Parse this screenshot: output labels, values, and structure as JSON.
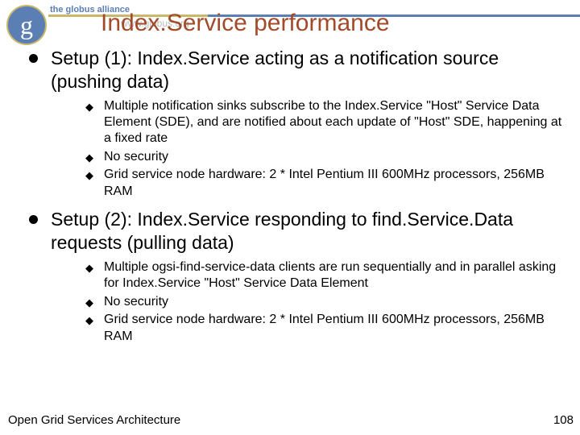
{
  "logo": {
    "title": "the globus alliance",
    "url": "www.globus.org",
    "g": "g"
  },
  "title": "Index.Service performance",
  "sections": [
    {
      "heading": "Setup (1): Index.Service acting as a notification source (pushing data)",
      "items": [
        "Multiple notification sinks subscribe to the Index.Service \"Host\" Service Data Element (SDE), and are notified about each update of \"Host\" SDE, happening at a fixed rate",
        "No security",
        "Grid service node hardware: 2 * Intel Pentium III 600MHz processors, 256MB RAM"
      ]
    },
    {
      "heading": "Setup (2): Index.Service responding to find.Service.Data requests (pulling data)",
      "items": [
        "Multiple ogsi-find-service-data clients are run sequentially and in parallel asking for Index.Service \"Host\" Service Data Element",
        "No security",
        "Grid service node hardware: 2 * Intel Pentium III 600MHz processors, 256MB RAM"
      ]
    }
  ],
  "footer": "Open Grid Services Architecture",
  "page": "108"
}
